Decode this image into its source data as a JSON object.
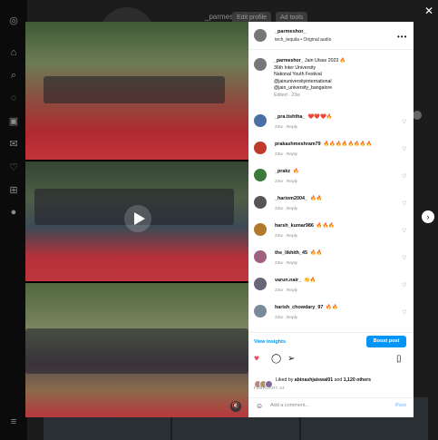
{
  "background_profile": {
    "username": "_parmeshor_",
    "edit_profile_label": "Edit profile",
    "ad_tools_label": "Ad tools"
  },
  "post": {
    "author": "_parmeshor_",
    "audio": "tech_tequila • Original audio",
    "caption": {
      "username": "_parmeshor_",
      "lines": [
        "Jain Utsav 2023 🔥",
        "36th Inter University",
        "National Youth Festival",
        "@jainuniversityinternational",
        "@jain_university_bangalore"
      ],
      "meta": "Edited · 23w"
    },
    "comments": [
      {
        "user": "_pra.tishtha_",
        "text": "❤️❤️❤️🔥",
        "time": "23w",
        "reply": "Reply"
      },
      {
        "user": "prakashmeshram79",
        "text": "🔥🔥🔥🔥🔥🔥🔥🔥",
        "time": "23w",
        "reply": "Reply"
      },
      {
        "user": "_prakz",
        "text": "🔥",
        "time": "23w",
        "reply": "Reply"
      },
      {
        "user": "_hariom2004_",
        "text": "🔥🔥",
        "time": "23w",
        "reply": "Reply"
      },
      {
        "user": "harsh_kumar986",
        "text": "🔥🔥🔥",
        "time": "23w",
        "reply": "Reply"
      },
      {
        "user": "the_likhith_45",
        "text": "🔥🔥",
        "time": "23w",
        "reply": "Reply"
      },
      {
        "user": "varun.nair_",
        "text": "👏🔥",
        "time": "23w",
        "reply": "Reply"
      },
      {
        "user": "harish_chowdary_97",
        "text": "🔥🔥",
        "time": "23w",
        "reply": "Reply"
      }
    ],
    "view_insights_label": "View insights",
    "boost_label": "Boost post",
    "likes": {
      "prefix": "Liked by",
      "user": "abinashjaiswal01",
      "middle": "and",
      "others": "1,120 others"
    },
    "date": "FEBRUARY 24",
    "add_comment_placeholder": "Add a comment...",
    "post_label": "Post"
  },
  "colors": {
    "accent": "#0095f6",
    "like": "#ed4956"
  },
  "icons": {
    "sidebar": [
      "instagram-icon",
      "home-icon",
      "search-icon",
      "explore-icon",
      "reels-icon",
      "messages-icon",
      "heart-icon",
      "create-icon",
      "profile-icon",
      "menu-icon"
    ],
    "actions": [
      "heart-icon",
      "comment-icon",
      "share-icon",
      "bookmark-icon"
    ]
  }
}
